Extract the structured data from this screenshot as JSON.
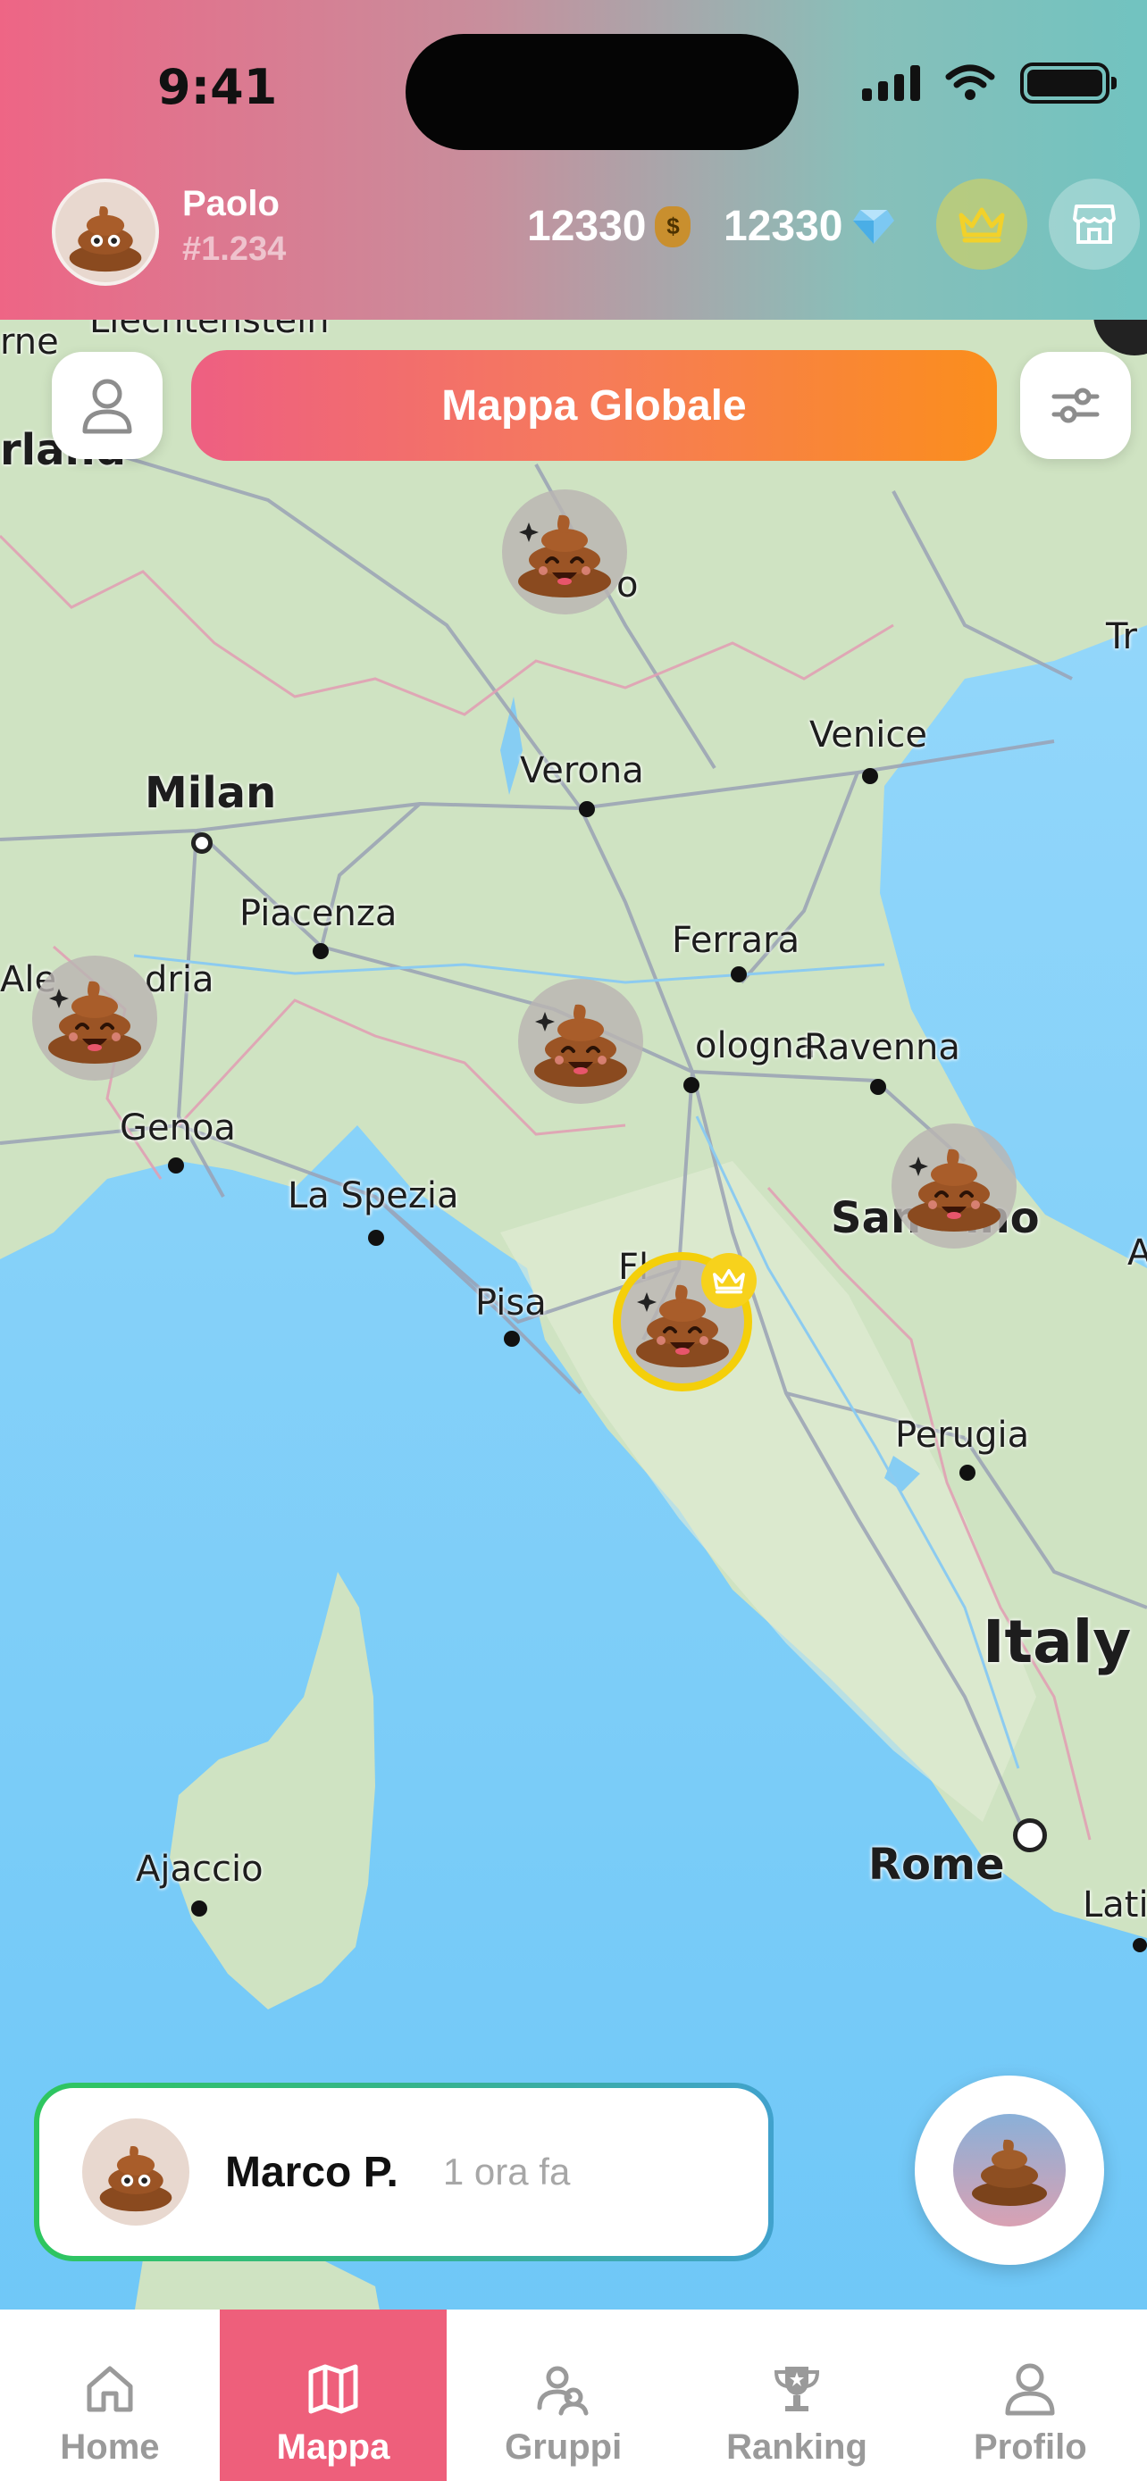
{
  "status_bar": {
    "time": "9:41"
  },
  "header": {
    "user": {
      "name": "Paolo",
      "id": "#1.234"
    },
    "coins": {
      "value": "12330",
      "icon": "money-bag-icon"
    },
    "gems": {
      "value": "12330",
      "icon": "diamond-icon"
    },
    "buttons": [
      "crown-icon",
      "shop-icon"
    ]
  },
  "map": {
    "title": "Mappa Globale",
    "labels": [
      {
        "text": "Liechtenstein",
        "size": "sm"
      },
      {
        "text": "rland",
        "size": "md"
      },
      {
        "text": "Milan",
        "size": "md"
      },
      {
        "text": "Verona",
        "size": "sm"
      },
      {
        "text": "Venice",
        "size": "sm"
      },
      {
        "text": "Piacenza",
        "size": "sm"
      },
      {
        "text": "Ferrara",
        "size": "sm"
      },
      {
        "text": "Ale",
        "size": "sm"
      },
      {
        "text": "dria",
        "size": "sm"
      },
      {
        "text": "ologna",
        "size": "sm"
      },
      {
        "text": "Ravenna",
        "size": "sm"
      },
      {
        "text": "Genoa",
        "size": "sm"
      },
      {
        "text": "La Spezia",
        "size": "sm"
      },
      {
        "text": "San",
        "size": "md"
      },
      {
        "text": "ino",
        "size": "md"
      },
      {
        "text": "Pisa",
        "size": "sm"
      },
      {
        "text": "Fl",
        "size": "sm"
      },
      {
        "text": "Perugia",
        "size": "sm"
      },
      {
        "text": "Italy",
        "size": "lg"
      },
      {
        "text": "Ajaccio",
        "size": "sm"
      },
      {
        "text": "Rome",
        "size": "md"
      },
      {
        "text": "Lati",
        "size": "sm"
      },
      {
        "text": "Tr",
        "size": "sm"
      },
      {
        "text": "A",
        "size": "sm"
      },
      {
        "text": "o",
        "size": "sm"
      },
      {
        "text": "rne",
        "size": "sm"
      }
    ],
    "markers": [
      {
        "type": "normal"
      },
      {
        "type": "normal"
      },
      {
        "type": "normal"
      },
      {
        "type": "normal"
      },
      {
        "type": "leader"
      }
    ]
  },
  "activity": {
    "name": "Marco P.",
    "time": "1 ora fa"
  },
  "tabs": [
    {
      "label": "Home",
      "icon": "home-icon",
      "active": false
    },
    {
      "label": "Mappa",
      "icon": "map-icon",
      "active": true
    },
    {
      "label": "Gruppi",
      "icon": "groups-icon",
      "active": false
    },
    {
      "label": "Ranking",
      "icon": "trophy-icon",
      "active": false
    },
    {
      "label": "Profilo",
      "icon": "profile-icon",
      "active": false
    }
  ],
  "colors": {
    "accent_pink": "#ee5f7b",
    "accent_orange": "#fb8e1c",
    "leader_gold": "#f4cf0a",
    "activity_green": "#2ec65f",
    "activity_blue": "#41a2cd"
  }
}
